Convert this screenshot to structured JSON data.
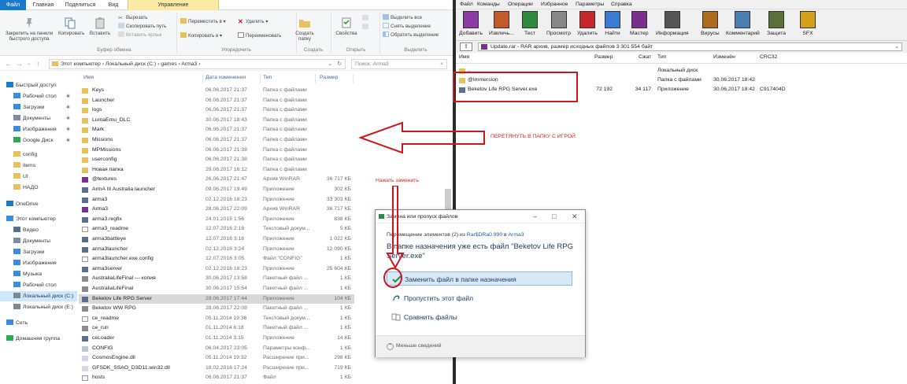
{
  "explorer": {
    "tabs": [
      "Файл",
      "Главная",
      "Поделиться",
      "Вид",
      "Управление"
    ],
    "ribbon": {
      "pin_label": "Закрепить на панели быстрого доступа",
      "copy_label": "Копировать",
      "paste_label": "Вставить",
      "cut_label": "Вырезать",
      "copy_path_label": "Скопировать путь",
      "paste_shortcut_label": "Вставить ярлык",
      "move_to_label": "Переместить в ▾",
      "copy_to_label": "Копировать в ▾",
      "delete_label": "Удалить ▾",
      "rename_label": "Переименовать",
      "new_folder_label": "Создать папку",
      "properties_label": "Свойства",
      "select_all_label": "Выделить все",
      "select_none_label": "Снять выделение",
      "invert_selection_label": "Обратить выделение",
      "group_clipboard": "Буфер обмена",
      "group_organize": "Упорядочить",
      "group_create": "Создать",
      "group_open": "Открыть",
      "group_select": "Выделить"
    },
    "path": "Этот компьютер  ›  Локальный диск (C:)  ›  games  ›  Arma3  ›",
    "search_placeholder": "Поиск: Arma3",
    "nav": [
      {
        "label": "Быстрый доступ",
        "icon": "star-icon",
        "pinned": false,
        "indent": 0
      },
      {
        "label": "Рабочий стол",
        "icon": "desktop-icon",
        "pinned": true,
        "indent": 1
      },
      {
        "label": "Загрузки",
        "icon": "download-icon",
        "pinned": true,
        "indent": 1
      },
      {
        "label": "Документы",
        "icon": "document-icon",
        "pinned": true,
        "indent": 1
      },
      {
        "label": "Изображения",
        "icon": "image-icon",
        "pinned": true,
        "indent": 1
      },
      {
        "label": "Google Диск",
        "icon": "google-drive-icon",
        "pinned": true,
        "indent": 1
      },
      {
        "label": "config",
        "icon": "folder-icon",
        "pinned": false,
        "indent": 1
      },
      {
        "label": "items",
        "icon": "folder-icon",
        "pinned": false,
        "indent": 1
      },
      {
        "label": "UI",
        "icon": "folder-icon",
        "pinned": false,
        "indent": 1
      },
      {
        "label": "НАДО",
        "icon": "folder-icon",
        "pinned": false,
        "indent": 1
      },
      {
        "label": "OneDrive",
        "icon": "cloud-icon",
        "pinned": false,
        "indent": 0
      },
      {
        "label": "Этот компьютер",
        "icon": "computer-icon",
        "pinned": false,
        "indent": 0
      },
      {
        "label": "Видео",
        "icon": "video-icon",
        "pinned": false,
        "indent": 1
      },
      {
        "label": "Документы",
        "icon": "document-icon",
        "pinned": false,
        "indent": 1
      },
      {
        "label": "Загрузки",
        "icon": "download-icon",
        "pinned": false,
        "indent": 1
      },
      {
        "label": "Изображения",
        "icon": "image-icon",
        "pinned": false,
        "indent": 1
      },
      {
        "label": "Музыка",
        "icon": "music-icon",
        "pinned": false,
        "indent": 1
      },
      {
        "label": "Рабочий стол",
        "icon": "desktop-icon",
        "pinned": false,
        "indent": 1
      },
      {
        "label": "Локальный диск (C:)",
        "icon": "drive-icon",
        "pinned": false,
        "indent": 1,
        "selected": true
      },
      {
        "label": "Локальный диск (E:)",
        "icon": "drive-icon",
        "pinned": false,
        "indent": 1
      },
      {
        "label": "Сеть",
        "icon": "network-icon",
        "pinned": false,
        "indent": 0
      },
      {
        "label": "Домашняя группа",
        "icon": "homegroup-icon",
        "pinned": false,
        "indent": 0
      }
    ],
    "columns": {
      "name": "Имя",
      "date": "Дата изменения",
      "type": "Тип",
      "size": "Размер"
    },
    "files": [
      {
        "name": "Keys",
        "date": "06.06.2017 21:37",
        "type": "Папка с файлами",
        "size": "",
        "icon": "folder-icon"
      },
      {
        "name": "Launcher",
        "date": "06.06.2017 21:37",
        "type": "Папка с файлами",
        "size": "",
        "icon": "folder-icon"
      },
      {
        "name": "logs",
        "date": "06.06.2017 21:37",
        "type": "Папка с файлами",
        "size": "",
        "icon": "folder-icon"
      },
      {
        "name": "LumaEmu_DLC",
        "date": "30.06.2017 18:43",
        "type": "Папка с файлами",
        "size": "",
        "icon": "folder-icon"
      },
      {
        "name": "Mark",
        "date": "06.06.2017 21:37",
        "type": "Папка с файлами",
        "size": "",
        "icon": "folder-icon"
      },
      {
        "name": "Missions",
        "date": "06.06.2017 21:37",
        "type": "Папка с файлами",
        "size": "",
        "icon": "folder-icon"
      },
      {
        "name": "MPMissions",
        "date": "06.06.2017 21:38",
        "type": "Папка с файлами",
        "size": "",
        "icon": "folder-icon"
      },
      {
        "name": "userconfig",
        "date": "06.06.2017 21:38",
        "type": "Папка с файлами",
        "size": "",
        "icon": "folder-icon"
      },
      {
        "name": "Новая папка",
        "date": "29.06.2017 16:12",
        "type": "Папка с файлами",
        "size": "",
        "icon": "folder-icon"
      },
      {
        "name": "@textures",
        "date": "26.06.2017 21:47",
        "type": "Архив WinRAR",
        "size": "36 717 КБ",
        "icon": "rar-icon"
      },
      {
        "name": "ArmA III Australia launcher",
        "date": "09.06.2017 19:49",
        "type": "Приложение",
        "size": "302 КБ",
        "icon": "app-icon"
      },
      {
        "name": "arma3",
        "date": "02.12.2016 18:23",
        "type": "Приложение",
        "size": "33 303 КБ",
        "icon": "app-icon"
      },
      {
        "name": "Arma3",
        "date": "28.06.2017 22:09",
        "type": "Архив WinRAR",
        "size": "36 717 КБ",
        "icon": "rar-icon"
      },
      {
        "name": "arma3.regfix",
        "date": "24.01.2015 1:56",
        "type": "Приложение",
        "size": "838 КБ",
        "icon": "app-icon"
      },
      {
        "name": "arma3_readme",
        "date": "12.07.2016 2:16",
        "type": "Текстовый докум...",
        "size": "5 КБ",
        "icon": "text-file-icon"
      },
      {
        "name": "arma3battleye",
        "date": "12.07.2016 3:16",
        "type": "Приложение",
        "size": "1 022 КБ",
        "icon": "app-icon"
      },
      {
        "name": "arma3launcher",
        "date": "02.12.2016 3:24",
        "type": "Приложение",
        "size": "12 090 КБ",
        "icon": "app-icon"
      },
      {
        "name": "arma3launcher.exe.config",
        "date": "12.07.2016 3:05",
        "type": "Файл \"CONFIG\"",
        "size": "1 КБ",
        "icon": "file-icon"
      },
      {
        "name": "arma3server",
        "date": "02.12.2016 18:23",
        "type": "Приложение",
        "size": "25 604 КБ",
        "icon": "app-icon"
      },
      {
        "name": "AustraliaLifeFinal — копия",
        "date": "30.06.2017 13:58",
        "type": "Пакетный файл ...",
        "size": "1 КБ",
        "icon": "batch-icon"
      },
      {
        "name": "AustraliaLifeFinal",
        "date": "30.06.2017 15:54",
        "type": "Пакетный файл ...",
        "size": "1 КБ",
        "icon": "batch-icon"
      },
      {
        "name": "Beketov Life RPG Server",
        "date": "29.06.2017 17:44",
        "type": "Приложение",
        "size": "104 КБ",
        "icon": "app-icon",
        "selected": true
      },
      {
        "name": "Beketov WW RPG",
        "date": "28.06.2017 22:08",
        "type": "Пакетный файл ...",
        "size": "1 КБ",
        "icon": "batch-icon"
      },
      {
        "name": "ce_readme",
        "date": "05.11.2014 19:36",
        "type": "Текстовый докум...",
        "size": "1 КБ",
        "icon": "text-file-icon"
      },
      {
        "name": "ce_run",
        "date": "01.11.2014 6:18",
        "type": "Пакетный файл ...",
        "size": "1 КБ",
        "icon": "batch-icon"
      },
      {
        "name": "ceLoader",
        "date": "01.11.2014 3:15",
        "type": "Приложение",
        "size": "14 КБ",
        "icon": "app-icon"
      },
      {
        "name": "CONFIG",
        "date": "06.04.2017 23:05",
        "type": "Параметры конф...",
        "size": "1 КБ",
        "icon": "config-icon"
      },
      {
        "name": "CosmosEngine.dll",
        "date": "05.11.2014 19:32",
        "type": "Расширение при...",
        "size": "298 КБ",
        "icon": "dll-icon"
      },
      {
        "name": "GFSDK_SSAO_D3D11.win32.dll",
        "date": "18.02.2016 17:24",
        "type": "Расширение при...",
        "size": "719 КБ",
        "icon": "dll-icon"
      },
      {
        "name": "hosts",
        "date": "06.06.2017 21:37",
        "type": "Файл",
        "size": "1 КБ",
        "icon": "file-icon"
      }
    ]
  },
  "winrar": {
    "menu": [
      "Файл",
      "Команды",
      "Операции",
      "Избранное",
      "Параметры",
      "Справка"
    ],
    "toolbar": [
      {
        "label": "Добавить",
        "icon": "winrar-add-icon"
      },
      {
        "label": "Извлечь...",
        "icon": "winrar-extract-icon"
      },
      {
        "label": "Тест",
        "icon": "winrar-test-icon"
      },
      {
        "label": "Просмотр",
        "icon": "winrar-view-icon"
      },
      {
        "label": "Удалить",
        "icon": "winrar-delete-icon"
      },
      {
        "label": "Найти",
        "icon": "winrar-find-icon"
      },
      {
        "label": "Мастер",
        "icon": "winrar-wizard-icon"
      },
      {
        "label": "Информация",
        "icon": "winrar-info-icon"
      },
      {
        "label": "Вирусы",
        "icon": "winrar-virus-icon"
      },
      {
        "label": "Комментарий",
        "icon": "winrar-comment-icon"
      },
      {
        "label": "Защита",
        "icon": "winrar-protect-icon"
      },
      {
        "label": "SFX",
        "icon": "winrar-sfx-icon"
      }
    ],
    "archive_path": "Update.rar - RAR архив, размер исходных файлов 3 301 554 байт",
    "columns": {
      "name": "Имя",
      "size": "Размер",
      "packed": "Сжат",
      "type": "Тип",
      "modified": "Изменён",
      "crc": "CRC32"
    },
    "rows": [
      {
        "name": "..",
        "size": "",
        "packed": "",
        "type": "Локальный диск",
        "modified": "",
        "crc": "",
        "icon": "up-folder-icon"
      },
      {
        "name": "@Immersion",
        "size": "",
        "packed": "",
        "type": "Папка с файлами",
        "modified": "30.06.2017 18:42",
        "crc": "",
        "icon": "folder-icon"
      },
      {
        "name": "Beketov Life RPG Server.exe",
        "size": "72 192",
        "packed": "34 117",
        "type": "Приложение",
        "modified": "30.06.2017 18:42",
        "crc": "C917404D",
        "icon": "app-icon"
      }
    ]
  },
  "annotations": {
    "drag_hint": "ПЕРЕТЯНУТЬ В ПАПКУ С ИГРОЙ",
    "replace_hint": "Нажать заменить"
  },
  "dialog": {
    "title": "Замена или пропуск файлов",
    "line_prefix": "Перемещение элементов (2) из ",
    "from": "Rar$DRa0.990",
    "line_mid": " в ",
    "to": "Arma3",
    "question": "В папке назначения уже есть файл \"Beketov Life RPG Server.exe\"",
    "options": [
      {
        "label": "Заменить файл в папке назначения",
        "icon": "check-icon",
        "active": true
      },
      {
        "label": "Пропустить этот файл",
        "icon": "skip-icon",
        "active": false
      },
      {
        "label": "Сравнить файлы",
        "icon": "compare-icon",
        "active": false
      }
    ],
    "fewer_details": "Меньше сведений"
  },
  "colors": {
    "accent": "#1979ca",
    "annotation": "#d4141d",
    "folder": "#e8c15c",
    "selection": "#cce8ff"
  }
}
